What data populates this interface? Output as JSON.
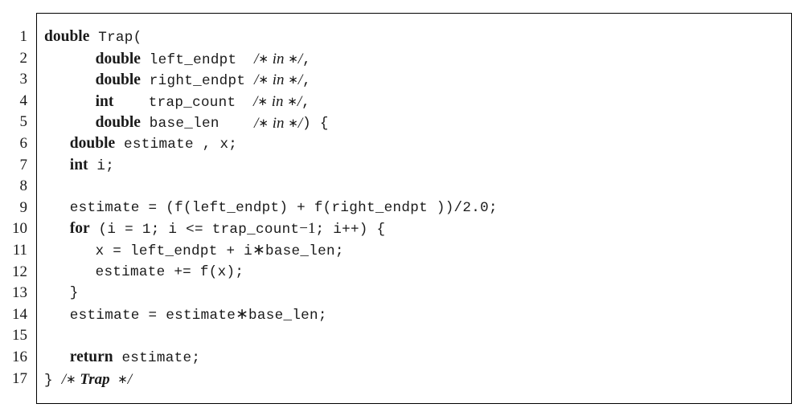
{
  "listing": {
    "language": "C",
    "function_name": "Trap",
    "frame": {
      "border_color": "#000000",
      "background_color": "#ffffff",
      "text_color": "#1a1a1a"
    },
    "line_numbers": [
      "1",
      "2",
      "3",
      "4",
      "5",
      "6",
      "7",
      "8",
      "9",
      "10",
      "11",
      "12",
      "13",
      "14",
      "15",
      "16",
      "17"
    ],
    "lines": [
      {
        "n": "1",
        "indent": 0,
        "kw": "double",
        "rest": " Trap("
      },
      {
        "n": "2",
        "indent": 6,
        "kw": "double",
        "mid": " left_endpt  ",
        "cmt_open": "/",
        "cmt_in": " in ",
        "cmt_close": "/",
        "tail": ","
      },
      {
        "n": "3",
        "indent": 6,
        "kw": "double",
        "mid": " right_endpt ",
        "cmt_open": "/",
        "cmt_in": " in ",
        "cmt_close": "/",
        "tail": ","
      },
      {
        "n": "4",
        "indent": 6,
        "kw": "int",
        "mid": "    trap_count  ",
        "cmt_open": "/",
        "cmt_in": " in ",
        "cmt_close": "/",
        "tail": ","
      },
      {
        "n": "5",
        "indent": 6,
        "kw": "double",
        "mid": " base_len    ",
        "cmt_open": "/",
        "cmt_in": " in ",
        "cmt_close": "/",
        "tail": ") {"
      },
      {
        "n": "6",
        "indent": 3,
        "kw": "double",
        "rest": " estimate , x;"
      },
      {
        "n": "7",
        "indent": 3,
        "kw": "int",
        "rest": " i;"
      },
      {
        "n": "8",
        "indent": 0,
        "rest": ""
      },
      {
        "n": "9",
        "indent": 3,
        "rest": "estimate = (f(left_endpt) + f(right_endpt ))/2.0;"
      },
      {
        "n": "10",
        "indent": 3,
        "kw": "for",
        "rest": " (i = 1; i <= trap_count",
        "minus": "−1",
        "rest2": "; i++) {"
      },
      {
        "n": "11",
        "indent": 6,
        "rest": "x = left_endpt + i",
        "star": "∗",
        "rest2": "base_len;"
      },
      {
        "n": "12",
        "indent": 6,
        "rest": "estimate += f(x);"
      },
      {
        "n": "13",
        "indent": 3,
        "rest": "}"
      },
      {
        "n": "14",
        "indent": 3,
        "rest": "estimate = estimate",
        "star": "∗",
        "rest2": "base_len;"
      },
      {
        "n": "15",
        "indent": 0,
        "rest": ""
      },
      {
        "n": "16",
        "indent": 3,
        "kw": "return",
        "rest": " estimate;"
      },
      {
        "n": "17",
        "indent": 0,
        "rest": "} ",
        "cmt_open": "/",
        "cmt_fn": " Trap  ",
        "cmt_close": "/"
      }
    ],
    "source_text": "double Trap(\n        double left_endpt  /* in */,\n        double right_endpt /* in */,\n        int    trap_count  /* in */,\n        double base_len    /* in */) {\n   double estimate , x;\n   int i;\n\n   estimate = (f(left_endpt) + f(right_endpt ))/2.0;\n   for (i = 1; i <= trap_count-1; i++) {\n      x = left_endpt + i*base_len;\n      estimate += f(x);\n   }\n   estimate = estimate*base_len;\n\n   return estimate;\n} /* Trap */"
  }
}
